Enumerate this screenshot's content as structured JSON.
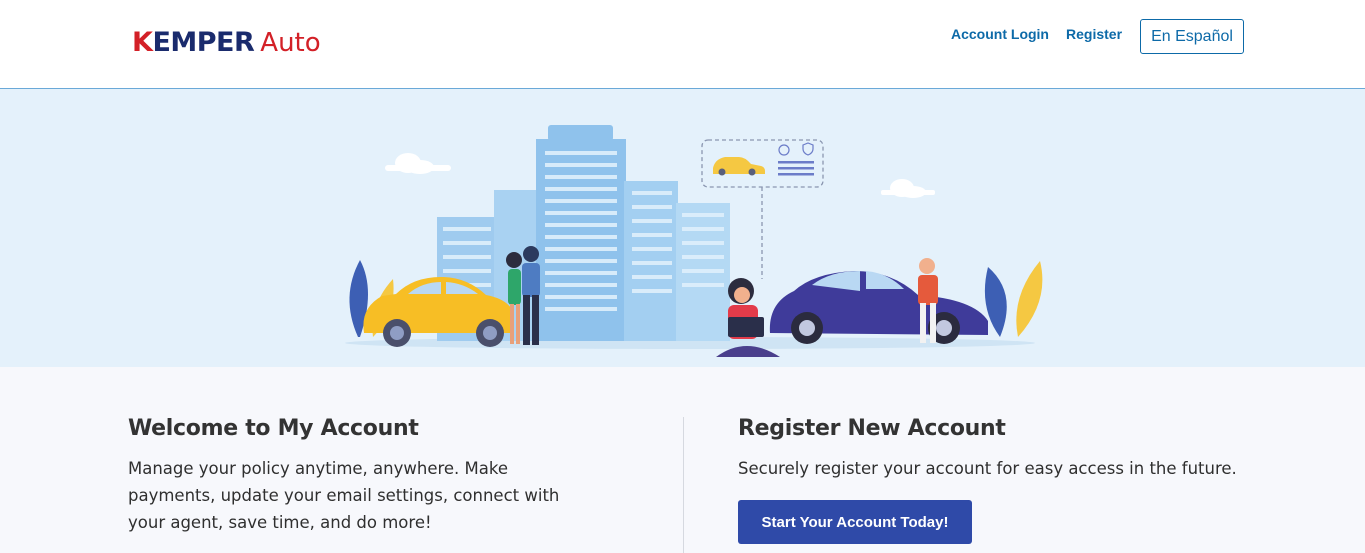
{
  "header": {
    "logo_brand": "KEMPER",
    "logo_product": "Auto",
    "nav": {
      "login_label": "Account Login",
      "register_label": "Register",
      "language_label": "En Español"
    }
  },
  "welcome": {
    "title": "Welcome to My Account",
    "description": "Manage your policy anytime, anywhere. Make payments, update your email settings, connect with your agent, save time, and do more!"
  },
  "register": {
    "title": "Register New Account",
    "description": "Securely register your account for easy access in the future.",
    "cta_label": "Start Your Account Today!"
  },
  "colors": {
    "brand_navy": "#1a2b6d",
    "brand_red": "#d32027",
    "link_blue": "#0d6aa8",
    "hero_bg": "#e4f1fb",
    "cta_blue": "#2f4aa8"
  }
}
